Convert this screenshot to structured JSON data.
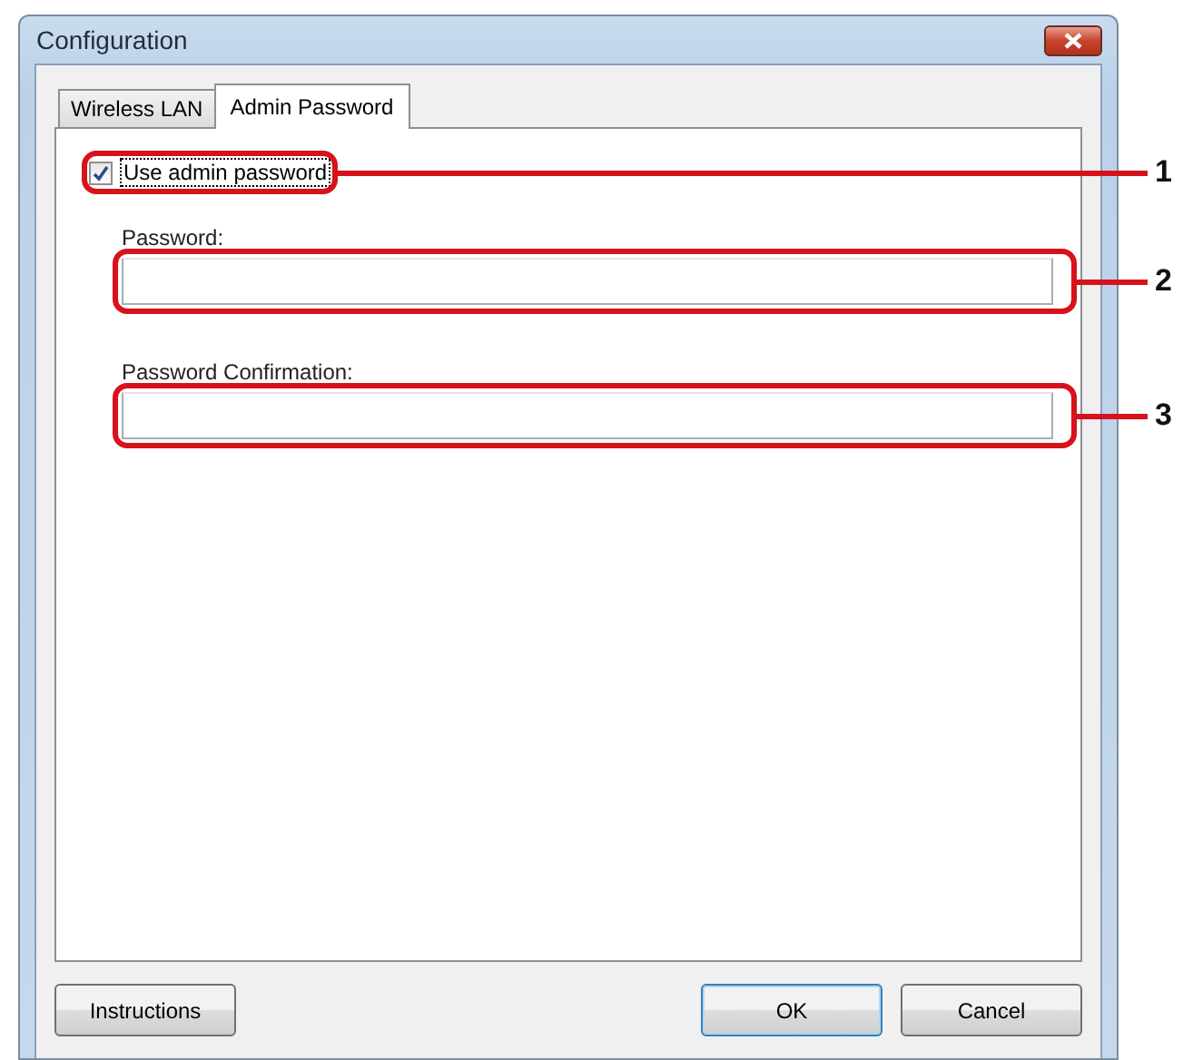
{
  "window": {
    "title": "Configuration"
  },
  "tabs": [
    {
      "label": "Wireless LAN",
      "selected": false
    },
    {
      "label": "Admin Password",
      "selected": true
    }
  ],
  "use_admin_password": {
    "label": "Use admin password",
    "checked": true
  },
  "fields": [
    {
      "label": "Password:"
    },
    {
      "label": "Password Confirmation:"
    }
  ],
  "buttons": [
    {
      "label": "Instructions",
      "kind": "help"
    },
    {
      "label": "OK",
      "kind": "default"
    },
    {
      "label": "Cancel",
      "kind": "cancel"
    }
  ],
  "callouts": [
    {
      "number": "1"
    },
    {
      "number": "2"
    },
    {
      "number": "3"
    }
  ]
}
